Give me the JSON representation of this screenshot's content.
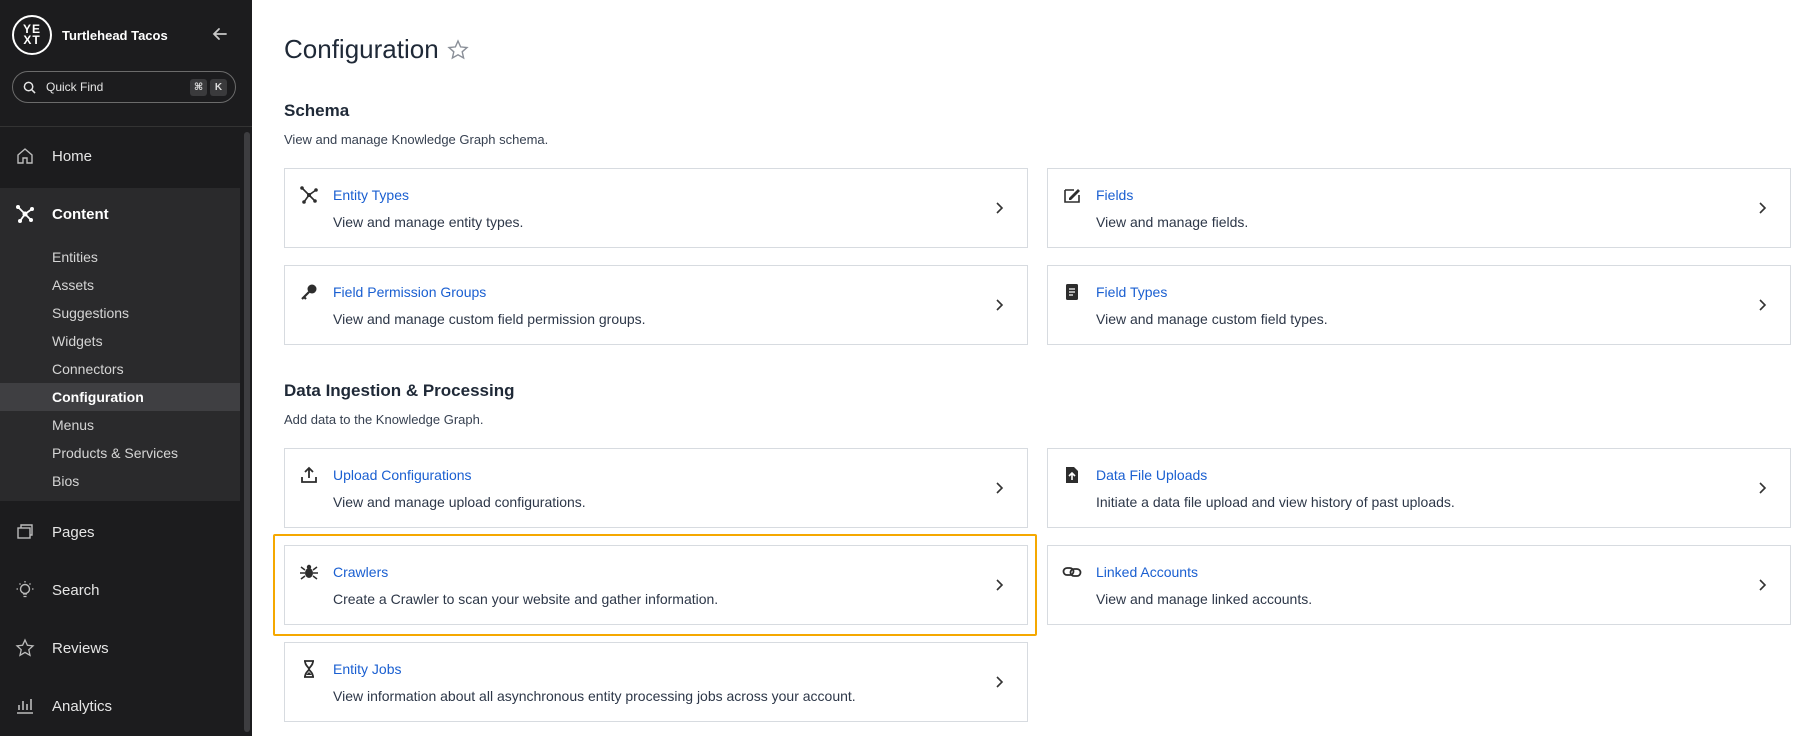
{
  "sidebar": {
    "logo_text": "YEXT",
    "org_name": "Turtlehead Tacos",
    "quick_find": {
      "label": "Quick Find",
      "key1": "⌘",
      "key2": "K"
    },
    "nav": {
      "home": "Home",
      "content": "Content",
      "pages": "Pages",
      "search": "Search",
      "reviews": "Reviews",
      "analytics": "Analytics"
    },
    "content_items": [
      "Entities",
      "Assets",
      "Suggestions",
      "Widgets",
      "Connectors",
      "Configuration",
      "Menus",
      "Products & Services",
      "Bios"
    ],
    "active_item": "Configuration"
  },
  "main": {
    "title": "Configuration",
    "schema": {
      "title": "Schema",
      "desc": "View and manage Knowledge Graph schema.",
      "cards": [
        {
          "title": "Entity Types",
          "desc": "View and manage entity types.",
          "icon": "entity-types-icon"
        },
        {
          "title": "Fields",
          "desc": "View and manage fields.",
          "icon": "fields-icon"
        },
        {
          "title": "Field Permission Groups",
          "desc": "View and manage custom field permission groups.",
          "icon": "key-icon"
        },
        {
          "title": "Field Types",
          "desc": "View and manage custom field types.",
          "icon": "document-icon"
        }
      ]
    },
    "ingestion": {
      "title": "Data Ingestion & Processing",
      "desc": "Add data to the Knowledge Graph.",
      "cards": [
        {
          "title": "Upload Configurations",
          "desc": "View and manage upload configurations.",
          "icon": "upload-icon"
        },
        {
          "title": "Data File Uploads",
          "desc": "Initiate a data file upload and view history of past uploads.",
          "icon": "file-upload-icon"
        },
        {
          "title": "Crawlers",
          "desc": "Create a Crawler to scan your website and gather information.",
          "icon": "spider-icon"
        },
        {
          "title": "Linked Accounts",
          "desc": "View and manage linked accounts.",
          "icon": "link-icon"
        },
        {
          "title": "Entity Jobs",
          "desc": "View information about all asynchronous entity processing jobs across your account.",
          "icon": "hourglass-icon"
        }
      ]
    }
  },
  "colors": {
    "sidebar_bg": "#1c1c1e",
    "link": "#1a5fd1",
    "highlight": "#f5a800"
  }
}
